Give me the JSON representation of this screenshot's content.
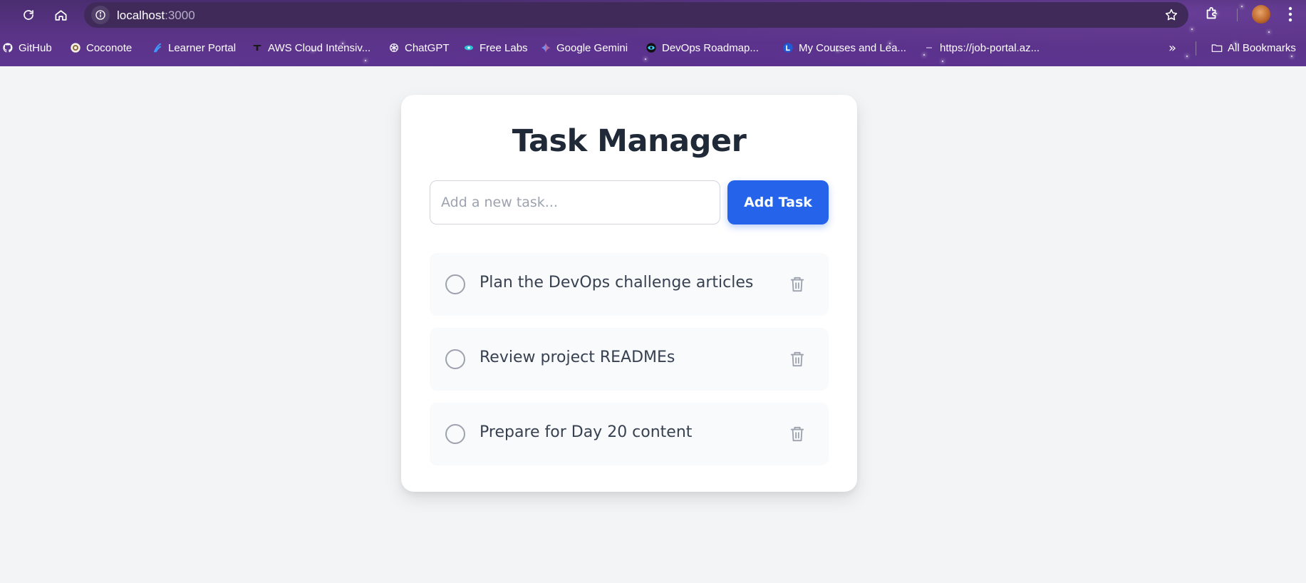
{
  "browser": {
    "url_host": "localhost",
    "url_port": ":3000",
    "bookmarks": [
      {
        "label": "GitHub",
        "icon": "github-icon"
      },
      {
        "label": "Coconote",
        "icon": "coconote-icon"
      },
      {
        "label": "Learner Portal",
        "icon": "learner-portal-icon"
      },
      {
        "label": "AWS Cloud Intensiv...",
        "icon": "aws-icon"
      },
      {
        "label": "ChatGPT",
        "icon": "chatgpt-icon"
      },
      {
        "label": "Free Labs",
        "icon": "free-labs-icon"
      },
      {
        "label": "Google Gemini",
        "icon": "gemini-icon"
      },
      {
        "label": "DevOps Roadmap...",
        "icon": "devops-roadmap-icon"
      },
      {
        "label": "My Courses and Lea...",
        "icon": "courses-icon"
      },
      {
        "label": "https://job-portal.az...",
        "icon": "job-portal-icon"
      }
    ],
    "more_bookmarks": "»",
    "all_bookmarks": "All Bookmarks"
  },
  "app": {
    "title": "Task Manager",
    "input_placeholder": "Add a new task...",
    "add_button_label": "Add Task",
    "tasks": [
      {
        "text": "Plan the DevOps challenge articles",
        "completed": false
      },
      {
        "text": "Review project READMEs",
        "completed": false
      },
      {
        "text": "Prepare for Day 20 content",
        "completed": false
      }
    ]
  },
  "colors": {
    "accent": "#2563eb",
    "page_background": "#f3f4f6",
    "card_background": "#ffffff",
    "task_background": "#f9fafb",
    "title_color": "#1f2937",
    "chrome_purple": "#5b3488"
  }
}
